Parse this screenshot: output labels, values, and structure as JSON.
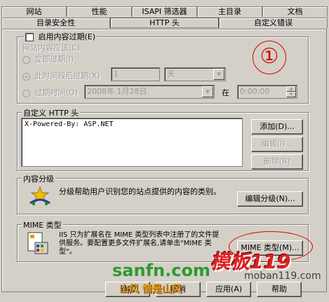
{
  "tabs_row1": [
    "网站",
    "性能",
    "ISAPI 筛选器",
    "主目录",
    "文档"
  ],
  "tabs_row2": [
    "目录安全性",
    "HTTP 头",
    "自定义错误"
  ],
  "selected_tab": "HTTP 头",
  "expiration": {
    "checkbox_label": "启用内容过期(E)",
    "checked": false,
    "subtitle": "网站内容应该(C):",
    "option_immediate": "立即过期(I)",
    "option_after": "此时间段后过期(X)",
    "after_value": "1",
    "after_unit": "天",
    "option_at": "过期时间(O)",
    "date_value": "2008年 1月28日",
    "at_label": "在",
    "time_value": "0:00:00",
    "annotation": "①"
  },
  "custom_headers": {
    "title": "自定义 HTTP 头",
    "items": [
      "X-Powered-By: ASP.NET"
    ],
    "add_label": "添加(D)...",
    "edit_label": "编辑(I)...",
    "delete_label": "删除(R)"
  },
  "content_rating": {
    "title": "内容分级",
    "description": "分级帮助用户识别您的站点提供的内容的类别。",
    "edit_label": "编辑分级(N)..."
  },
  "mime": {
    "title": "MIME 类型",
    "description": "IIS 只为扩展名在 MIME 类型列表中注册了的文件提供服务。要配置更多文件扩展名,请单击\"MIME 类型\"。",
    "button_label": "MIME 类型(M)..."
  },
  "footer": {
    "ok_label": "确定",
    "cancel_label": "取消",
    "apply_label": "应用(A)",
    "help_label": "帮助"
  },
  "watermarks": {
    "left": "sanfn.com",
    "left_sub": "山风 情是山风",
    "right": "模板119",
    "right_sub": "moban119.com"
  },
  "colors": {
    "dialog_bg": "#d4d0c8",
    "annotation_red": "#d80000",
    "watermark_green": "#2e9a2e",
    "watermark_red": "#e02020"
  }
}
